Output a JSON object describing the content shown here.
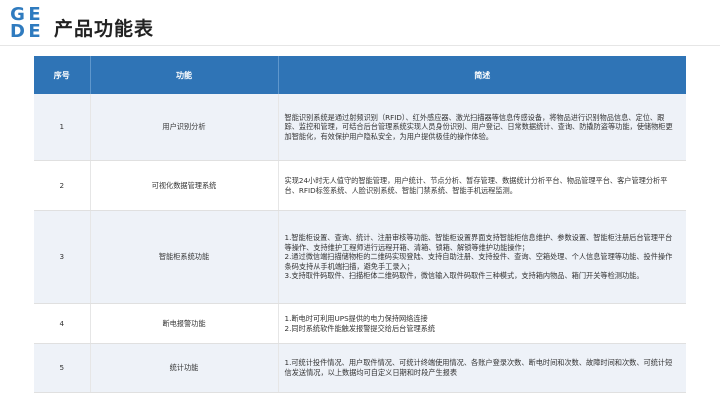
{
  "logo": {
    "letters": [
      "G",
      "E",
      "D",
      "E"
    ]
  },
  "page_title": "产品功能表",
  "table": {
    "headers": {
      "seq": "序号",
      "function": "功能",
      "description": "简述"
    },
    "rows": [
      {
        "seq": "1",
        "function": "用户识别分析",
        "description": "智能识别系统是通过射频识别（RFID）、红外感应器、激光扫描器等信息传感设备，将物品进行识别物品信息、定位、跟踪、监控和管理，可结合后台管理系统实现人员身份识别、用户登记、日常数据统计、查询、防撬防盗等功能，使储物柜更加智能化，有效保护用户隐私安全，为用户提供极佳的操作体验。"
      },
      {
        "seq": "2",
        "function": "可视化数据管理系统",
        "description": "实现24小时无人值守的智能管理，用户统计、节点分析、暂存管理、数据统计分析平台、物品管理平台、客户管理分析平台、RFID标签系统、人脸识别系统、智能门禁系统、智能手机远程监测。"
      },
      {
        "seq": "3",
        "function": "智能柜系统功能",
        "description": "1.智能柜设置、查询、统计、注册审核等功能、智能柜设置界面支持智能柜信息维护、参数设置、智能柜注册后台管理平台等操作、支持维护工程师进行远程开箱、清箱、锁箱、解锁等维护功能操作；\n2.通过微信端扫描储物柜的二维码实现登陆、支持自助注册、支持投件、查询、空箱处理、个人信息管理等功能、投件操作条码支持从手机端扫描，避免手工录入；\n3.支持取件码取件、扫描柜体二维码取件，微信输入取件码取件三种模式，支持箱内物品、箱门开关等检测功能。"
      },
      {
        "seq": "4",
        "function": "断电报警功能",
        "description": "1.断电时可利用UPS提供的电力保持网络连接\n2.同时系统软件能触发报警提交给后台管理系统"
      },
      {
        "seq": "5",
        "function": "统计功能",
        "description": "1.可统计投件情况、用户取件情况、可统计终端使用情况、各账户登录次数、断电时间和次数、故障时间和次数、可统计短信发送情况，以上数据均可自定义日期和时段产生报表"
      }
    ]
  }
}
